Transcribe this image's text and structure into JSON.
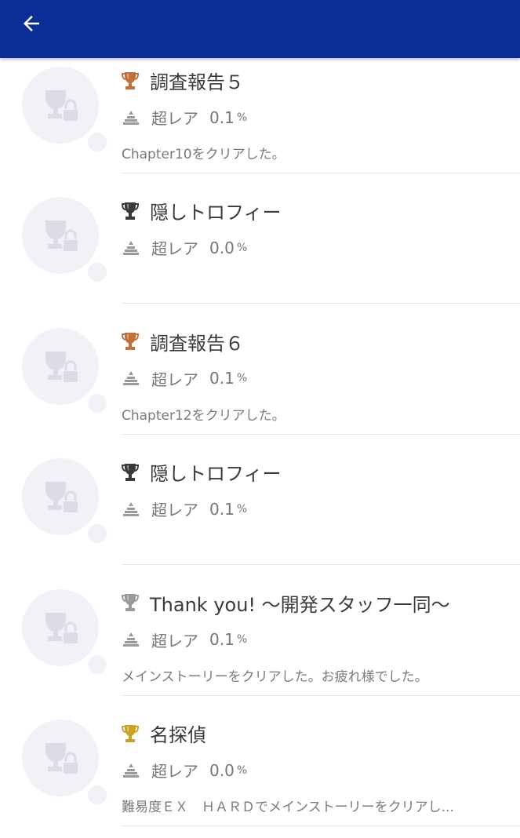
{
  "appbar": {
    "back_icon": "arrow-left-icon",
    "color": "#0a2e95"
  },
  "rarity_label": "超レア",
  "percent_sign": "%",
  "trophies": [
    {
      "tier": "bronze",
      "title": "調査報告５",
      "rarity": "超レア",
      "percent": "0.1",
      "description": "Chapter10をクリアした。"
    },
    {
      "tier": "hidden",
      "title": "隠しトロフィー",
      "rarity": "超レア",
      "percent": "0.0",
      "description": ""
    },
    {
      "tier": "bronze",
      "title": "調査報告６",
      "rarity": "超レア",
      "percent": "0.1",
      "description": "Chapter12をクリアした。"
    },
    {
      "tier": "hidden",
      "title": "隠しトロフィー",
      "rarity": "超レア",
      "percent": "0.1",
      "description": ""
    },
    {
      "tier": "silver",
      "title": "Thank you! 〜開発スタッフ一同〜",
      "rarity": "超レア",
      "percent": "0.1",
      "description": "メインストーリーをクリアした。お疲れ様でした。"
    },
    {
      "tier": "gold",
      "title": "名探偵",
      "rarity": "超レア",
      "percent": "0.0",
      "description": "難易度ＥＸ　ＨＡＲＤでメインストーリーをクリアし..."
    }
  ],
  "colors": {
    "bronze": "#c0703a",
    "silver": "#9a9a9a",
    "gold": "#c9a227",
    "hidden": "#3a3a3a"
  }
}
